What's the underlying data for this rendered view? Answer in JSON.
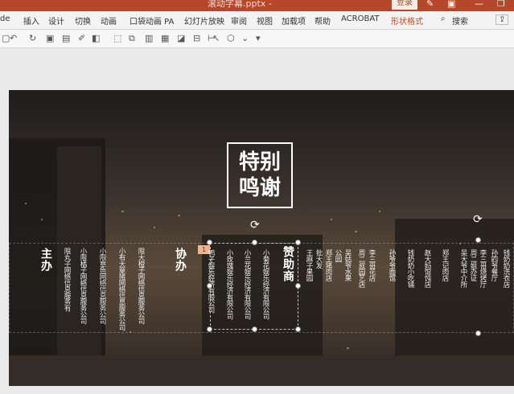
{
  "titlebar": {
    "title": "滚动字幕.pptx - ",
    "login": "登录"
  },
  "ribbon": {
    "tabs": [
      "de",
      "插入",
      "设计",
      "切换",
      "动画",
      "口袋动画 PA",
      "幻灯片放映",
      "审阅",
      "视图",
      "加载项",
      "帮助",
      "ACROBAT",
      "形状格式"
    ],
    "active_tab": "形状格式",
    "search": "搜索"
  },
  "slide": {
    "title_lines": [
      "特别",
      "鸣谢"
    ],
    "zhuban_label": "主办",
    "zhuban_orgs": [
      "限丸子网络信息服务有",
      "小限橘子网络信息服务公司",
      "小限章鱼网络信息服务公司",
      "小有大章猪网络信息服务公司",
      "限大橙子网络信息服务公司"
    ],
    "xieban_label": "协办",
    "xieban_orgs": [
      "鸭子娱乐经济有限公司",
      "小玫瑰娱乐经济有限公司",
      "小兰花娱乐经济有限公司",
      "小菊花娱乐经济有限公司"
    ],
    "zanzhu_label": "赞助商",
    "zanzhu_items": [
      "王麻子果园",
      "批大发",
      "郑王猪肉店",
      "公园",
      "吴姑爷水果",
      "周二叔园艺店",
      "李三哥花店",
      "孙爷爷面馆",
      "钱奶奶小吃铺",
      "赵大妈馄饨店",
      "郑王记肉店",
      "吴大爷中介所",
      "周二姐办证",
      "李三哥烧烤厅",
      "孙四爷餐厅",
      "钱奶奶洗衣店"
    ],
    "tag_number": "1"
  },
  "colors": {
    "brand": "#b7472a",
    "slide_bg": "#2a2624"
  }
}
